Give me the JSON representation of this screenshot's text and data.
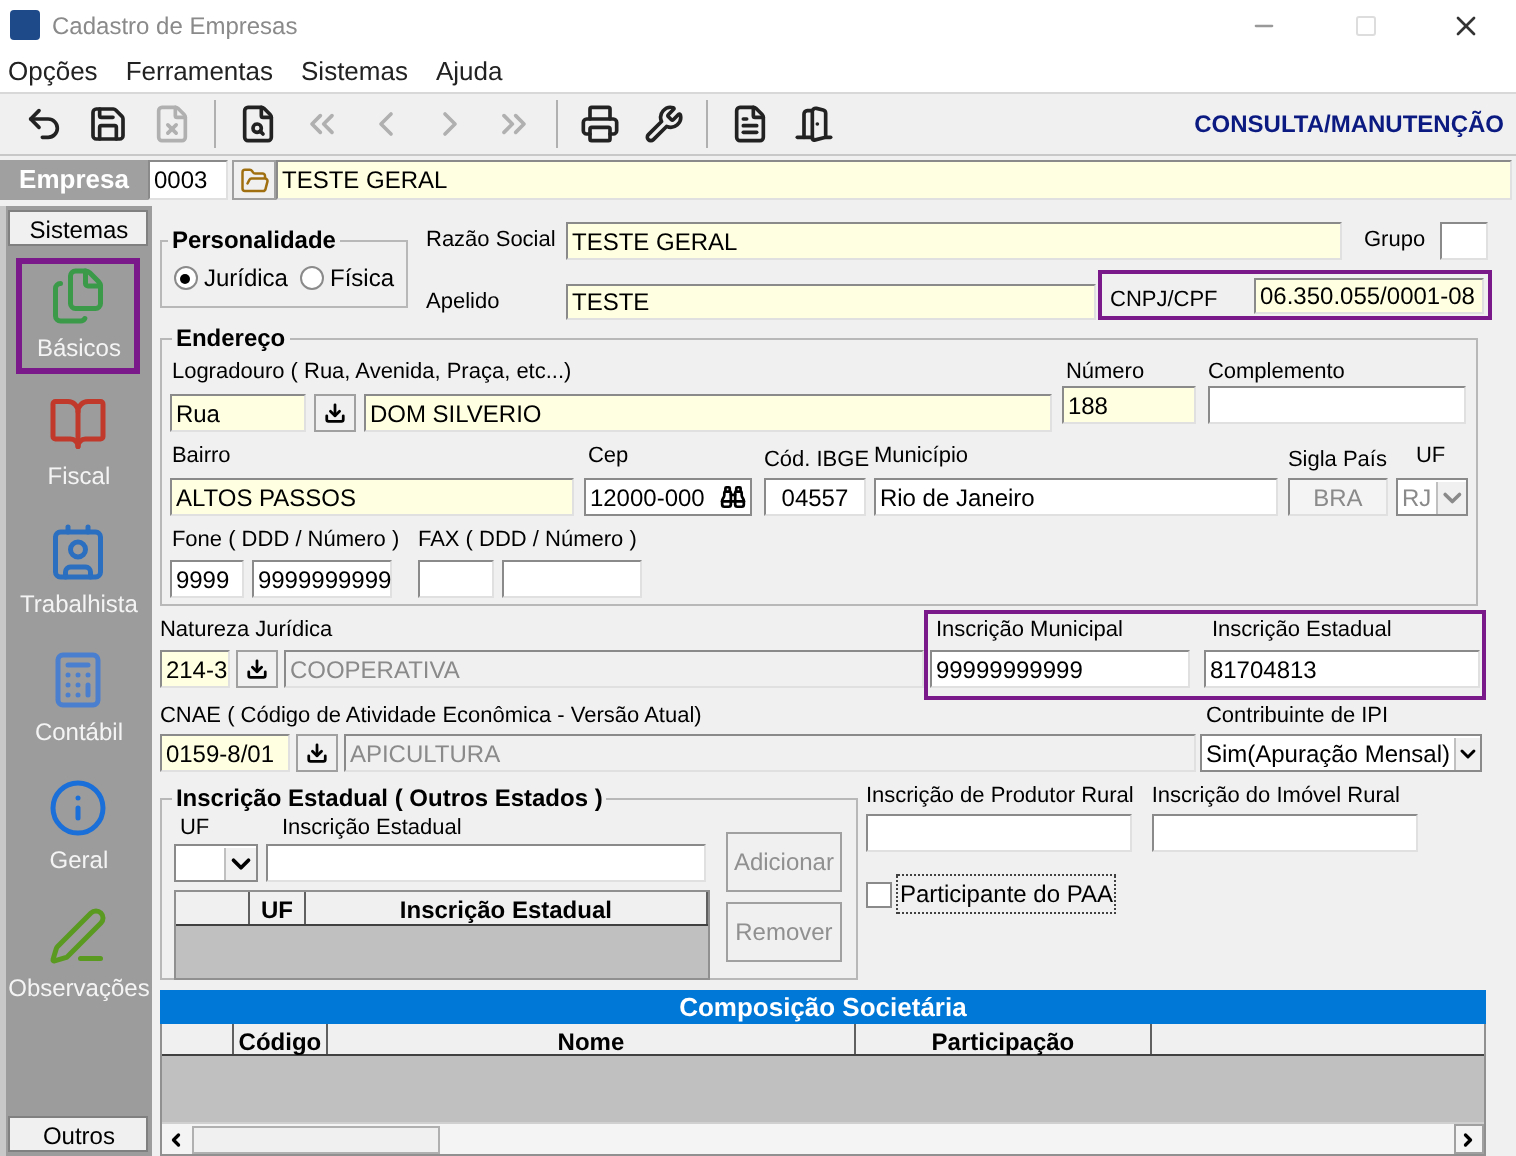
{
  "window": {
    "title": "Cadastro de Empresas"
  },
  "menu": [
    "Opções",
    "Ferramentas",
    "Sistemas",
    "Ajuda"
  ],
  "toolbar": [
    {
      "kind": "undo",
      "disabled": false
    },
    {
      "kind": "save",
      "disabled": false
    },
    {
      "kind": "delete",
      "disabled": true
    },
    {
      "kind": "sep"
    },
    {
      "kind": "preview",
      "disabled": false
    },
    {
      "kind": "first",
      "disabled": true
    },
    {
      "kind": "prev",
      "disabled": true
    },
    {
      "kind": "next",
      "disabled": true
    },
    {
      "kind": "last",
      "disabled": true
    },
    {
      "kind": "sep"
    },
    {
      "kind": "print",
      "disabled": false
    },
    {
      "kind": "tools",
      "disabled": false
    },
    {
      "kind": "sep"
    },
    {
      "kind": "report",
      "disabled": false
    },
    {
      "kind": "exit",
      "disabled": false
    }
  ],
  "mode": "CONSULTA/MANUTENÇÃO",
  "empresa": {
    "label": "Empresa",
    "code": "0003",
    "name": "TESTE GERAL"
  },
  "sidebar": {
    "header": "Sistemas",
    "footer": "Outros",
    "items": [
      {
        "label": "Básicos",
        "kind": "basic",
        "selected": true
      },
      {
        "label": "Fiscal",
        "kind": "fiscal",
        "selected": false
      },
      {
        "label": "Trabalhista",
        "kind": "labor",
        "selected": false
      },
      {
        "label": "Contábil",
        "kind": "accounting",
        "selected": false
      },
      {
        "label": "Geral",
        "kind": "general",
        "selected": false
      },
      {
        "label": "Observações",
        "kind": "notes",
        "selected": false
      }
    ]
  },
  "personalidade": {
    "title": "Personalidade",
    "options": [
      {
        "label": "Jurídica",
        "selected": true
      },
      {
        "label": "Física",
        "selected": false
      }
    ]
  },
  "razao_social": {
    "label": "Razão Social",
    "value": "TESTE GERAL"
  },
  "grupo": {
    "label": "Grupo"
  },
  "apelido": {
    "label": "Apelido",
    "value": "TESTE"
  },
  "cnpj": {
    "label": "CNPJ/CPF",
    "value": "06.350.055/0001-08",
    "highlighted": true
  },
  "endereco": {
    "title": "Endereço",
    "logradouro": {
      "label": "Logradouro ( Rua, Avenida, Praça, etc...)",
      "type": "Rua",
      "value": "DOM SILVERIO"
    },
    "numero": {
      "label": "Número",
      "value": "188"
    },
    "complemento": {
      "label": "Complemento"
    },
    "bairro": {
      "label": "Bairro",
      "value": "ALTOS PASSOS"
    },
    "cep": {
      "label": "Cep",
      "value": "12000-000"
    },
    "ibge": {
      "label": "Cód. IBGE",
      "value": "04557"
    },
    "municipio": {
      "label": "Município",
      "value": "Rio de Janeiro"
    },
    "pais": {
      "label": "Sigla País",
      "value": "BRA",
      "disabled": true
    },
    "uf": {
      "label": "UF",
      "value": "RJ",
      "disabled": true
    },
    "fone": {
      "label": "Fone ( DDD / Número )",
      "ddd": "9999",
      "numero": "9999999999"
    },
    "fax": {
      "label": "FAX ( DDD / Número )"
    }
  },
  "natureza": {
    "label": "Natureza Jurídica",
    "code": "214-3",
    "description": "COOPERATIVA",
    "disabled": true
  },
  "inscricoes": {
    "highlighted": true,
    "municipal": {
      "label": "Inscrição Municipal",
      "value": "99999999999"
    },
    "estadual": {
      "label": "Inscrição Estadual",
      "value": "81704813"
    }
  },
  "cnae": {
    "label": "CNAE ( Código de Atividade Econômica - Versão Atual)",
    "code": "0159-8/01",
    "description": "APICULTURA",
    "disabled": true
  },
  "ipi": {
    "label": "Contribuinte de IPI",
    "value": "Sim(Apuração Mensal)"
  },
  "outros_estados": {
    "title": "Inscrição Estadual ( Outros Estados )",
    "uf_label": "UF",
    "ie_label": "Inscrição Estadual",
    "buttons": [
      {
        "label": "Adicionar",
        "disabled": true
      },
      {
        "label": "Remover",
        "disabled": true
      }
    ],
    "columns": [
      "UF",
      "Inscrição Estadual"
    ]
  },
  "produtor_rural": {
    "label": "Inscrição de Produtor Rural"
  },
  "imovel_rural": {
    "label": "Inscrição do Imóvel Rural"
  },
  "paa": {
    "label": "Participante do PAA",
    "checked": false
  },
  "composicao": {
    "title": "Composição Societária",
    "columns": [
      "Código",
      "Nome",
      "Participação"
    ]
  }
}
